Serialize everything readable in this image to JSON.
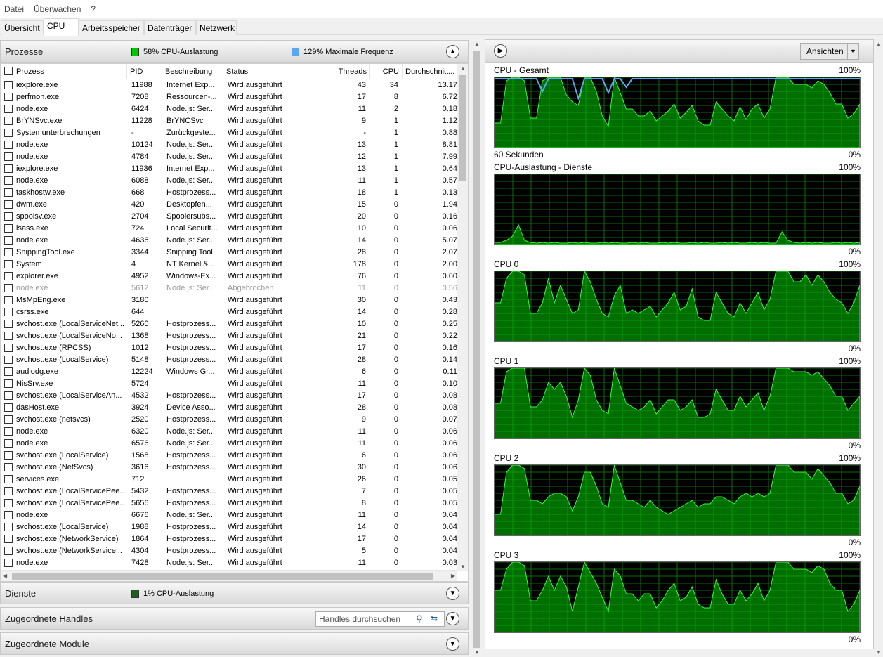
{
  "menu": {
    "items": [
      "Datei",
      "Überwachen",
      "?"
    ]
  },
  "tabs": [
    {
      "label": "Übersicht"
    },
    {
      "label": "CPU"
    },
    {
      "label": "Arbeitsspeicher"
    },
    {
      "label": "Datenträger"
    },
    {
      "label": "Netzwerk"
    }
  ],
  "processes": {
    "title": "Prozesse",
    "cpu_usage": "58% CPU-Auslastung",
    "max_freq": "129% Maximale Frequenz",
    "cpu_color": "#00c800",
    "freq_color": "#5ba7f2",
    "columns": {
      "name": "Prozess",
      "pid": "PID",
      "desc": "Beschreibung",
      "status": "Status",
      "threads": "Threads",
      "cpu": "CPU",
      "avg": "Durchschnitt..."
    },
    "rows": [
      [
        "iexplore.exe",
        "11988",
        "Internet Exp...",
        "Wird ausgeführt",
        "43",
        "34",
        "13.17"
      ],
      [
        "perfmon.exe",
        "7208",
        "Ressourcen-...",
        "Wird ausgeführt",
        "17",
        "8",
        "6.72"
      ],
      [
        "node.exe",
        "6424",
        "Node.js: Ser...",
        "Wird ausgeführt",
        "11",
        "2",
        "0.18"
      ],
      [
        "BrYNSvc.exe",
        "11228",
        "BrYNCSvc",
        "Wird ausgeführt",
        "9",
        "1",
        "1.12"
      ],
      [
        "Systemunterbrechungen",
        "-",
        "Zurückgeste...",
        "Wird ausgeführt",
        "-",
        "1",
        "0.88"
      ],
      [
        "node.exe",
        "10124",
        "Node.js: Ser...",
        "Wird ausgeführt",
        "13",
        "1",
        "8.81"
      ],
      [
        "node.exe",
        "4784",
        "Node.js: Ser...",
        "Wird ausgeführt",
        "12",
        "1",
        "7.99"
      ],
      [
        "iexplore.exe",
        "11936",
        "Internet Exp...",
        "Wird ausgeführt",
        "13",
        "1",
        "0.64"
      ],
      [
        "node.exe",
        "6088",
        "Node.js: Ser...",
        "Wird ausgeführt",
        "11",
        "1",
        "0.57"
      ],
      [
        "taskhostw.exe",
        "668",
        "Hostprozess...",
        "Wird ausgeführt",
        "18",
        "1",
        "0.13"
      ],
      [
        "dwm.exe",
        "420",
        "Desktopfen...",
        "Wird ausgeführt",
        "15",
        "0",
        "1.94"
      ],
      [
        "spoolsv.exe",
        "2704",
        "Spoolersubs...",
        "Wird ausgeführt",
        "20",
        "0",
        "0.16"
      ],
      [
        "lsass.exe",
        "724",
        "Local Securit...",
        "Wird ausgeführt",
        "10",
        "0",
        "0.06"
      ],
      [
        "node.exe",
        "4636",
        "Node.js: Ser...",
        "Wird ausgeführt",
        "14",
        "0",
        "5.07"
      ],
      [
        "SnippingTool.exe",
        "3344",
        "Snipping Tool",
        "Wird ausgeführt",
        "28",
        "0",
        "2.07"
      ],
      [
        "System",
        "4",
        "NT Kernel & ...",
        "Wird ausgeführt",
        "178",
        "0",
        "2.00"
      ],
      [
        "explorer.exe",
        "4952",
        "Windows-Ex...",
        "Wird ausgeführt",
        "76",
        "0",
        "0.60"
      ],
      [
        "node.exe",
        "5612",
        "Node.js: Ser...",
        "Abgebrochen",
        "11",
        "0",
        "0.56"
      ],
      [
        "MsMpEng.exe",
        "3180",
        "",
        "Wird ausgeführt",
        "30",
        "0",
        "0.43"
      ],
      [
        "csrss.exe",
        "644",
        "",
        "Wird ausgeführt",
        "14",
        "0",
        "0.28"
      ],
      [
        "svchost.exe (LocalServiceNet...",
        "5260",
        "Hostprozess...",
        "Wird ausgeführt",
        "10",
        "0",
        "0.25"
      ],
      [
        "svchost.exe (LocalServiceNo...",
        "1368",
        "Hostprozess...",
        "Wird ausgeführt",
        "21",
        "0",
        "0.22"
      ],
      [
        "svchost.exe (RPCSS)",
        "1012",
        "Hostprozess...",
        "Wird ausgeführt",
        "17",
        "0",
        "0.16"
      ],
      [
        "svchost.exe (LocalService)",
        "5148",
        "Hostprozess...",
        "Wird ausgeführt",
        "28",
        "0",
        "0.14"
      ],
      [
        "audiodg.exe",
        "12224",
        "Windows Gr...",
        "Wird ausgeführt",
        "6",
        "0",
        "0.11"
      ],
      [
        "NisSrv.exe",
        "5724",
        "",
        "Wird ausgeführt",
        "11",
        "0",
        "0.10"
      ],
      [
        "svchost.exe (LocalServiceAn...",
        "4532",
        "Hostprozess...",
        "Wird ausgeführt",
        "17",
        "0",
        "0.08"
      ],
      [
        "dasHost.exe",
        "3924",
        "Device Asso...",
        "Wird ausgeführt",
        "28",
        "0",
        "0.08"
      ],
      [
        "svchost.exe (netsvcs)",
        "2520",
        "Hostprozess...",
        "Wird ausgeführt",
        "9",
        "0",
        "0.07"
      ],
      [
        "node.exe",
        "6320",
        "Node.js: Ser...",
        "Wird ausgeführt",
        "11",
        "0",
        "0.06"
      ],
      [
        "node.exe",
        "6576",
        "Node.js: Ser...",
        "Wird ausgeführt",
        "11",
        "0",
        "0.06"
      ],
      [
        "svchost.exe (LocalService)",
        "1568",
        "Hostprozess...",
        "Wird ausgeführt",
        "6",
        "0",
        "0.06"
      ],
      [
        "svchost.exe (NetSvcs)",
        "3616",
        "Hostprozess...",
        "Wird ausgeführt",
        "30",
        "0",
        "0.06"
      ],
      [
        "services.exe",
        "712",
        "",
        "Wird ausgeführt",
        "26",
        "0",
        "0.05"
      ],
      [
        "svchost.exe (LocalServicePee...",
        "5432",
        "Hostprozess...",
        "Wird ausgeführt",
        "7",
        "0",
        "0.05"
      ],
      [
        "svchost.exe (LocalServicePee...",
        "5656",
        "Hostprozess...",
        "Wird ausgeführt",
        "8",
        "0",
        "0.05"
      ],
      [
        "node.exe",
        "6676",
        "Node.js: Ser...",
        "Wird ausgeführt",
        "11",
        "0",
        "0.04"
      ],
      [
        "svchost.exe (LocalService)",
        "1988",
        "Hostprozess...",
        "Wird ausgeführt",
        "14",
        "0",
        "0.04"
      ],
      [
        "svchost.exe (NetworkService)",
        "1864",
        "Hostprozess...",
        "Wird ausgeführt",
        "17",
        "0",
        "0.04"
      ],
      [
        "svchost.exe (NetworkService...",
        "4304",
        "Hostprozess...",
        "Wird ausgeführt",
        "5",
        "0",
        "0.04"
      ],
      [
        "node.exe",
        "7428",
        "Node.js: Ser...",
        "Wird ausgeführt",
        "11",
        "0",
        "0.03"
      ]
    ]
  },
  "services": {
    "title": "Dienste",
    "cpu_usage": "1% CPU-Auslastung",
    "color": "#1f5f1f"
  },
  "handles": {
    "title": "Zugeordnete Handles",
    "search_placeholder": "Handles durchsuchen"
  },
  "modules": {
    "title": "Zugeordnete Module"
  },
  "views_button": "Ansichten",
  "graphs": [
    {
      "title": "CPU - Gesamt",
      "max": "100%",
      "min": "0%",
      "footer": "60 Sekunden",
      "values": [
        35,
        35,
        95,
        100,
        100,
        95,
        42,
        42,
        95,
        100,
        100,
        100,
        75,
        65,
        60,
        100,
        100,
        80,
        45,
        30,
        100,
        78,
        55,
        55,
        45,
        45,
        52,
        38,
        45,
        52,
        62,
        42,
        50,
        60,
        38,
        32,
        32,
        65,
        55,
        45,
        38,
        58,
        40,
        55,
        62,
        42,
        55,
        100,
        100,
        100,
        90,
        90,
        90,
        85,
        95,
        90,
        78,
        62,
        62,
        42,
        48,
        62
      ],
      "freq": [
        98,
        98,
        98,
        98,
        98,
        98,
        98,
        98,
        80,
        98,
        98,
        98,
        98,
        98,
        70,
        98,
        98,
        98,
        98,
        78,
        98,
        98,
        86,
        98,
        98,
        98,
        98,
        98,
        98,
        98,
        98,
        98,
        98,
        98,
        98,
        98,
        98,
        98,
        98,
        98,
        98,
        98,
        98,
        98,
        98,
        98,
        98,
        98,
        98,
        98,
        98,
        98,
        98,
        98,
        98,
        98,
        98,
        98,
        98,
        98,
        98,
        98
      ]
    },
    {
      "title": "CPU-Auslastung - Dienste",
      "max": "100%",
      "min": "0%",
      "values": [
        3,
        3,
        6,
        12,
        28,
        6,
        3,
        2,
        3,
        2,
        3,
        2,
        2,
        3,
        2,
        3,
        2,
        2,
        3,
        2,
        3,
        2,
        2,
        3,
        2,
        3,
        2,
        2,
        3,
        2,
        3,
        2,
        2,
        3,
        2,
        3,
        2,
        2,
        3,
        2,
        3,
        2,
        2,
        3,
        2,
        3,
        2,
        2,
        18,
        6,
        3,
        2,
        3,
        2,
        3,
        2,
        2,
        3,
        2,
        3,
        2,
        3
      ]
    },
    {
      "title": "CPU 0",
      "max": "100%",
      "min": "0%",
      "values": [
        55,
        55,
        90,
        100,
        100,
        95,
        40,
        40,
        55,
        90,
        55,
        80,
        60,
        40,
        45,
        100,
        85,
        60,
        40,
        35,
        65,
        80,
        40,
        45,
        40,
        45,
        50,
        35,
        45,
        55,
        70,
        45,
        50,
        75,
        35,
        30,
        30,
        70,
        55,
        40,
        35,
        55,
        40,
        55,
        70,
        45,
        60,
        100,
        100,
        100,
        85,
        85,
        95,
        80,
        95,
        85,
        70,
        60,
        55,
        40,
        55,
        80
      ]
    },
    {
      "title": "CPU 1",
      "max": "100%",
      "min": "0%",
      "values": [
        50,
        50,
        95,
        100,
        100,
        100,
        45,
        45,
        55,
        80,
        70,
        80,
        60,
        30,
        55,
        100,
        90,
        55,
        40,
        35,
        100,
        75,
        50,
        45,
        40,
        45,
        55,
        35,
        45,
        55,
        55,
        40,
        45,
        55,
        30,
        30,
        35,
        70,
        55,
        40,
        40,
        60,
        45,
        55,
        65,
        40,
        60,
        100,
        100,
        100,
        95,
        95,
        95,
        90,
        95,
        85,
        75,
        60,
        60,
        40,
        50,
        60
      ]
    },
    {
      "title": "CPU 2",
      "max": "100%",
      "min": "0%",
      "values": [
        30,
        30,
        90,
        100,
        100,
        95,
        50,
        50,
        45,
        55,
        60,
        60,
        55,
        35,
        55,
        90,
        90,
        70,
        45,
        40,
        100,
        75,
        50,
        50,
        45,
        40,
        50,
        40,
        35,
        30,
        35,
        40,
        45,
        50,
        40,
        45,
        45,
        55,
        55,
        50,
        45,
        55,
        60,
        55,
        60,
        55,
        60,
        100,
        100,
        100,
        90,
        90,
        90,
        80,
        95,
        85,
        75,
        60,
        60,
        45,
        50,
        70
      ]
    },
    {
      "title": "CPU 3",
      "max": "100%",
      "min": "0%",
      "values": [
        60,
        60,
        90,
        100,
        100,
        95,
        45,
        45,
        60,
        80,
        60,
        80,
        65,
        30,
        65,
        100,
        85,
        70,
        50,
        30,
        90,
        80,
        55,
        55,
        45,
        55,
        55,
        35,
        45,
        60,
        70,
        45,
        50,
        65,
        40,
        35,
        35,
        75,
        55,
        40,
        40,
        60,
        45,
        55,
        70,
        45,
        60,
        100,
        100,
        100,
        90,
        90,
        90,
        85,
        95,
        90,
        70,
        60,
        60,
        30,
        40,
        60
      ]
    }
  ]
}
